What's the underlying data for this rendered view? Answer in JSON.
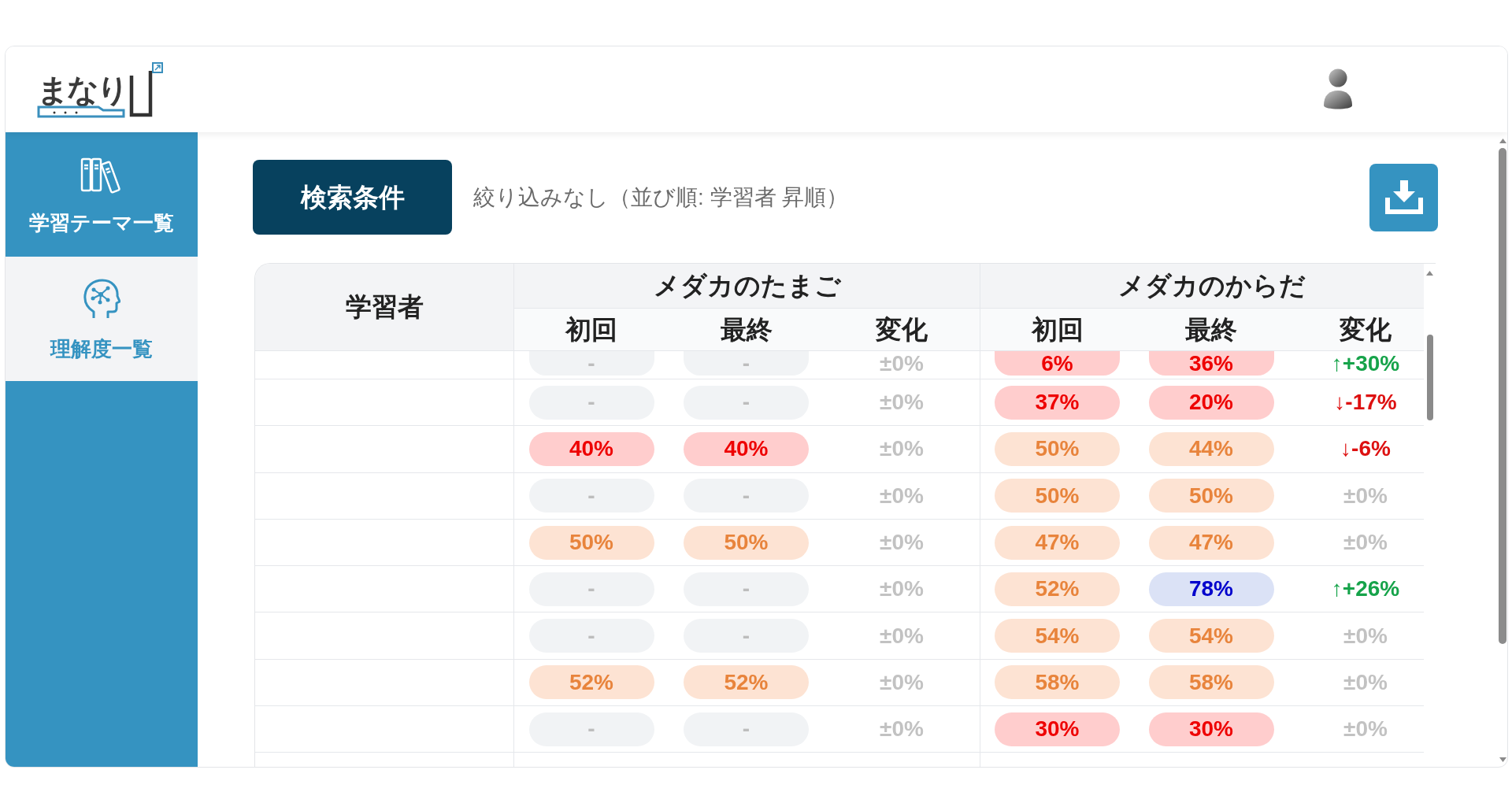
{
  "header": {
    "logo": {
      "text": "まなり"
    }
  },
  "sidebar": {
    "items": [
      {
        "label": "学習テーマ一覧",
        "selected": false
      },
      {
        "label": "理解度一覧",
        "selected": true
      }
    ]
  },
  "toolbar": {
    "search_button": {
      "label": "検索条件"
    },
    "filter_summary": "絞り込みなし（並び順: 学習者 昇順）"
  },
  "table": {
    "learner_header": "学習者",
    "groups": [
      {
        "title": "メダカのたまご",
        "columns": [
          "初回",
          "最終",
          "変化"
        ]
      },
      {
        "title": "メダカのからだ",
        "columns": [
          "初回",
          "最終",
          "変化"
        ]
      }
    ],
    "rows": [
      {
        "cells": [
          {
            "kind": "empty",
            "value": "-"
          },
          {
            "kind": "empty",
            "value": "-"
          },
          {
            "kind": "flat",
            "value": "±0%"
          },
          {
            "kind": "low",
            "value": "6%"
          },
          {
            "kind": "low",
            "value": "36%"
          },
          {
            "kind": "up",
            "value": "↑+30%"
          }
        ]
      },
      {
        "cells": [
          {
            "kind": "empty",
            "value": "-"
          },
          {
            "kind": "empty",
            "value": "-"
          },
          {
            "kind": "flat",
            "value": "±0%"
          },
          {
            "kind": "low",
            "value": "37%"
          },
          {
            "kind": "low",
            "value": "20%"
          },
          {
            "kind": "down",
            "value": "↓-17%"
          }
        ]
      },
      {
        "cells": [
          {
            "kind": "low",
            "value": "40%"
          },
          {
            "kind": "low",
            "value": "40%"
          },
          {
            "kind": "flat",
            "value": "±0%"
          },
          {
            "kind": "mid",
            "value": "50%"
          },
          {
            "kind": "mid",
            "value": "44%"
          },
          {
            "kind": "down",
            "value": "↓-6%"
          }
        ]
      },
      {
        "cells": [
          {
            "kind": "empty",
            "value": "-"
          },
          {
            "kind": "empty",
            "value": "-"
          },
          {
            "kind": "flat",
            "value": "±0%"
          },
          {
            "kind": "mid",
            "value": "50%"
          },
          {
            "kind": "mid",
            "value": "50%"
          },
          {
            "kind": "flat",
            "value": "±0%"
          }
        ]
      },
      {
        "cells": [
          {
            "kind": "mid",
            "value": "50%"
          },
          {
            "kind": "mid",
            "value": "50%"
          },
          {
            "kind": "flat",
            "value": "±0%"
          },
          {
            "kind": "mid",
            "value": "47%"
          },
          {
            "kind": "mid",
            "value": "47%"
          },
          {
            "kind": "flat",
            "value": "±0%"
          }
        ]
      },
      {
        "cells": [
          {
            "kind": "empty",
            "value": "-"
          },
          {
            "kind": "empty",
            "value": "-"
          },
          {
            "kind": "flat",
            "value": "±0%"
          },
          {
            "kind": "mid",
            "value": "52%"
          },
          {
            "kind": "high",
            "value": "78%"
          },
          {
            "kind": "up",
            "value": "↑+26%"
          }
        ]
      },
      {
        "cells": [
          {
            "kind": "empty",
            "value": "-"
          },
          {
            "kind": "empty",
            "value": "-"
          },
          {
            "kind": "flat",
            "value": "±0%"
          },
          {
            "kind": "mid",
            "value": "54%"
          },
          {
            "kind": "mid",
            "value": "54%"
          },
          {
            "kind": "flat",
            "value": "±0%"
          }
        ]
      },
      {
        "cells": [
          {
            "kind": "mid",
            "value": "52%"
          },
          {
            "kind": "mid",
            "value": "52%"
          },
          {
            "kind": "flat",
            "value": "±0%"
          },
          {
            "kind": "mid",
            "value": "58%"
          },
          {
            "kind": "mid",
            "value": "58%"
          },
          {
            "kind": "flat",
            "value": "±0%"
          }
        ]
      },
      {
        "cells": [
          {
            "kind": "empty",
            "value": "-"
          },
          {
            "kind": "empty",
            "value": "-"
          },
          {
            "kind": "flat",
            "value": "±0%"
          },
          {
            "kind": "low",
            "value": "30%"
          },
          {
            "kind": "low",
            "value": "30%"
          },
          {
            "kind": "flat",
            "value": "±0%"
          }
        ]
      }
    ]
  }
}
